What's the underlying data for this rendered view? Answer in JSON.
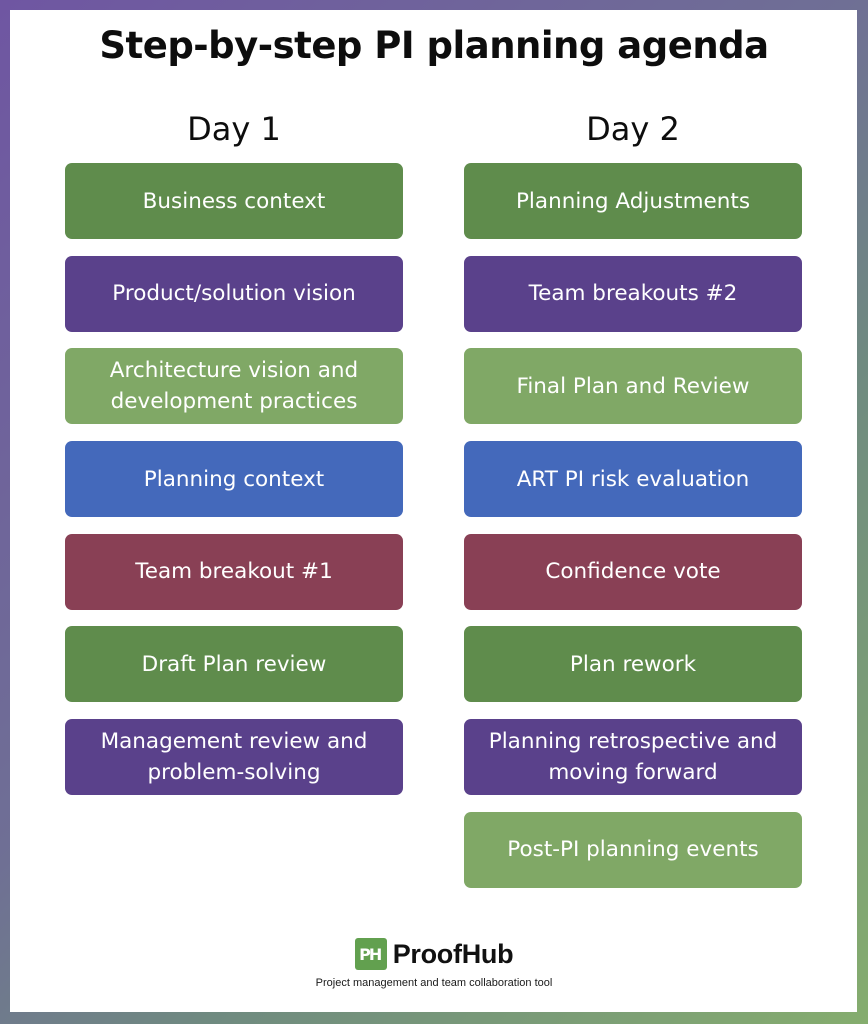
{
  "title": "Step-by-step PI planning agenda",
  "colors": {
    "border_gradient": [
      "#6f56a2",
      "#85ad6e"
    ],
    "dark_green": "#5f8c4c",
    "purple": "#5a418b",
    "light_green": "#80a866",
    "blue": "#4469bb",
    "maroon": "#894055",
    "brand_green": "#62a04f"
  },
  "days": [
    {
      "label": "Day 1",
      "items": [
        {
          "label": "Business context",
          "color": "dark_green"
        },
        {
          "label": "Product/solution vision",
          "color": "purple"
        },
        {
          "label": "Architecture vision and development practices",
          "color": "light_green"
        },
        {
          "label": "Planning context",
          "color": "blue"
        },
        {
          "label": "Team breakout #1",
          "color": "maroon"
        },
        {
          "label": "Draft Plan review",
          "color": "dark_green"
        },
        {
          "label": "Management review and problem-solving",
          "color": "purple"
        }
      ]
    },
    {
      "label": "Day 2",
      "items": [
        {
          "label": "Planning Adjustments",
          "color": "dark_green"
        },
        {
          "label": "Team breakouts #2",
          "color": "purple"
        },
        {
          "label": "Final Plan and Review",
          "color": "light_green"
        },
        {
          "label": "ART PI risk evaluation",
          "color": "blue"
        },
        {
          "label": "Confidence vote",
          "color": "maroon"
        },
        {
          "label": "Plan rework",
          "color": "dark_green"
        },
        {
          "label": "Planning retrospective and moving forward",
          "color": "purple"
        },
        {
          "label": "Post-PI planning events",
          "color": "light_green"
        }
      ]
    }
  ],
  "brand": {
    "logo_text": "PH",
    "name": "ProofHub",
    "tagline": "Project management and team collaboration tool"
  }
}
